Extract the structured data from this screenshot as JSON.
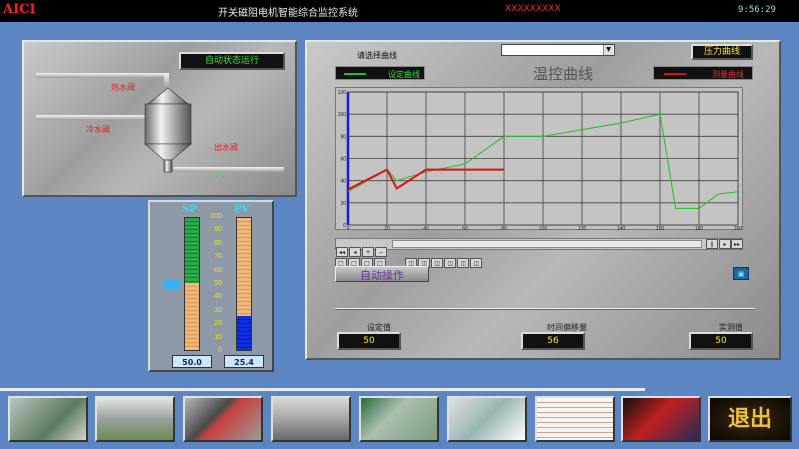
{
  "titlebar": {
    "brand": "AICI",
    "title": "开关磁阻电机智能综合监控系统",
    "company": "XXXXXXXXX",
    "clock": "9:56:29"
  },
  "process": {
    "status_label": "自动状态运行",
    "hot_valve": "热水阀",
    "cold_valve": "冷水阀",
    "outlet_valve": "出水阀",
    "marker": "0°C"
  },
  "gauges": {
    "sp_label": "SP",
    "pv_label": "PV",
    "sp_value": "50.0",
    "pv_value": "25.4",
    "sp_level": 0.5,
    "pv_level": 0.254,
    "scale": [
      "100",
      "90",
      "80",
      "70",
      "60",
      "50",
      "40",
      "30",
      "20",
      "10",
      "0"
    ],
    "colors": {
      "sp_fill": "#2aa84a",
      "pv_fill": "#1030e0"
    }
  },
  "trend": {
    "select_prompt": "请选择曲线",
    "dropdown_value": "",
    "pressure_button": "压力曲线",
    "setpoint_legend": "设定曲线",
    "measured_legend": "测量曲线",
    "title": "温控曲线",
    "auto_button": "自动操作",
    "setpoint_label": "设定值",
    "setpoint_value": "50",
    "offset_label": "时间偏移量",
    "offset_value": "56",
    "measured_label": "实测值",
    "measured_value": "50",
    "colors": {
      "setpoint": "#20c020",
      "measured": "#e01010"
    }
  },
  "chart_data": {
    "type": "line",
    "xlim": [
      0,
      200
    ],
    "ylim": [
      0,
      120
    ],
    "xticks": [
      "0",
      "20",
      "40",
      "60",
      "80",
      "100",
      "120",
      "140",
      "160",
      "180",
      "200"
    ],
    "yticks": [
      "0",
      "20",
      "40",
      "60",
      "80",
      "100",
      "120"
    ],
    "series": [
      {
        "name": "设定曲线",
        "color": "#20c020",
        "x": [
          0,
          20,
          25,
          40,
          60,
          80,
          100,
          140,
          160,
          168,
          180,
          190,
          200
        ],
        "y": [
          30,
          50,
          40,
          48,
          55,
          80,
          80,
          92,
          100,
          15,
          15,
          28,
          30
        ]
      },
      {
        "name": "测量曲线",
        "color": "#e01010",
        "x": [
          0,
          20,
          25,
          40,
          60,
          80
        ],
        "y": [
          32,
          50,
          33,
          50,
          50,
          50
        ]
      }
    ]
  },
  "thumbnails": [
    "t1",
    "t2",
    "t3",
    "t4",
    "t5",
    "t6",
    "t7",
    "t8"
  ],
  "exit_label": "退出"
}
